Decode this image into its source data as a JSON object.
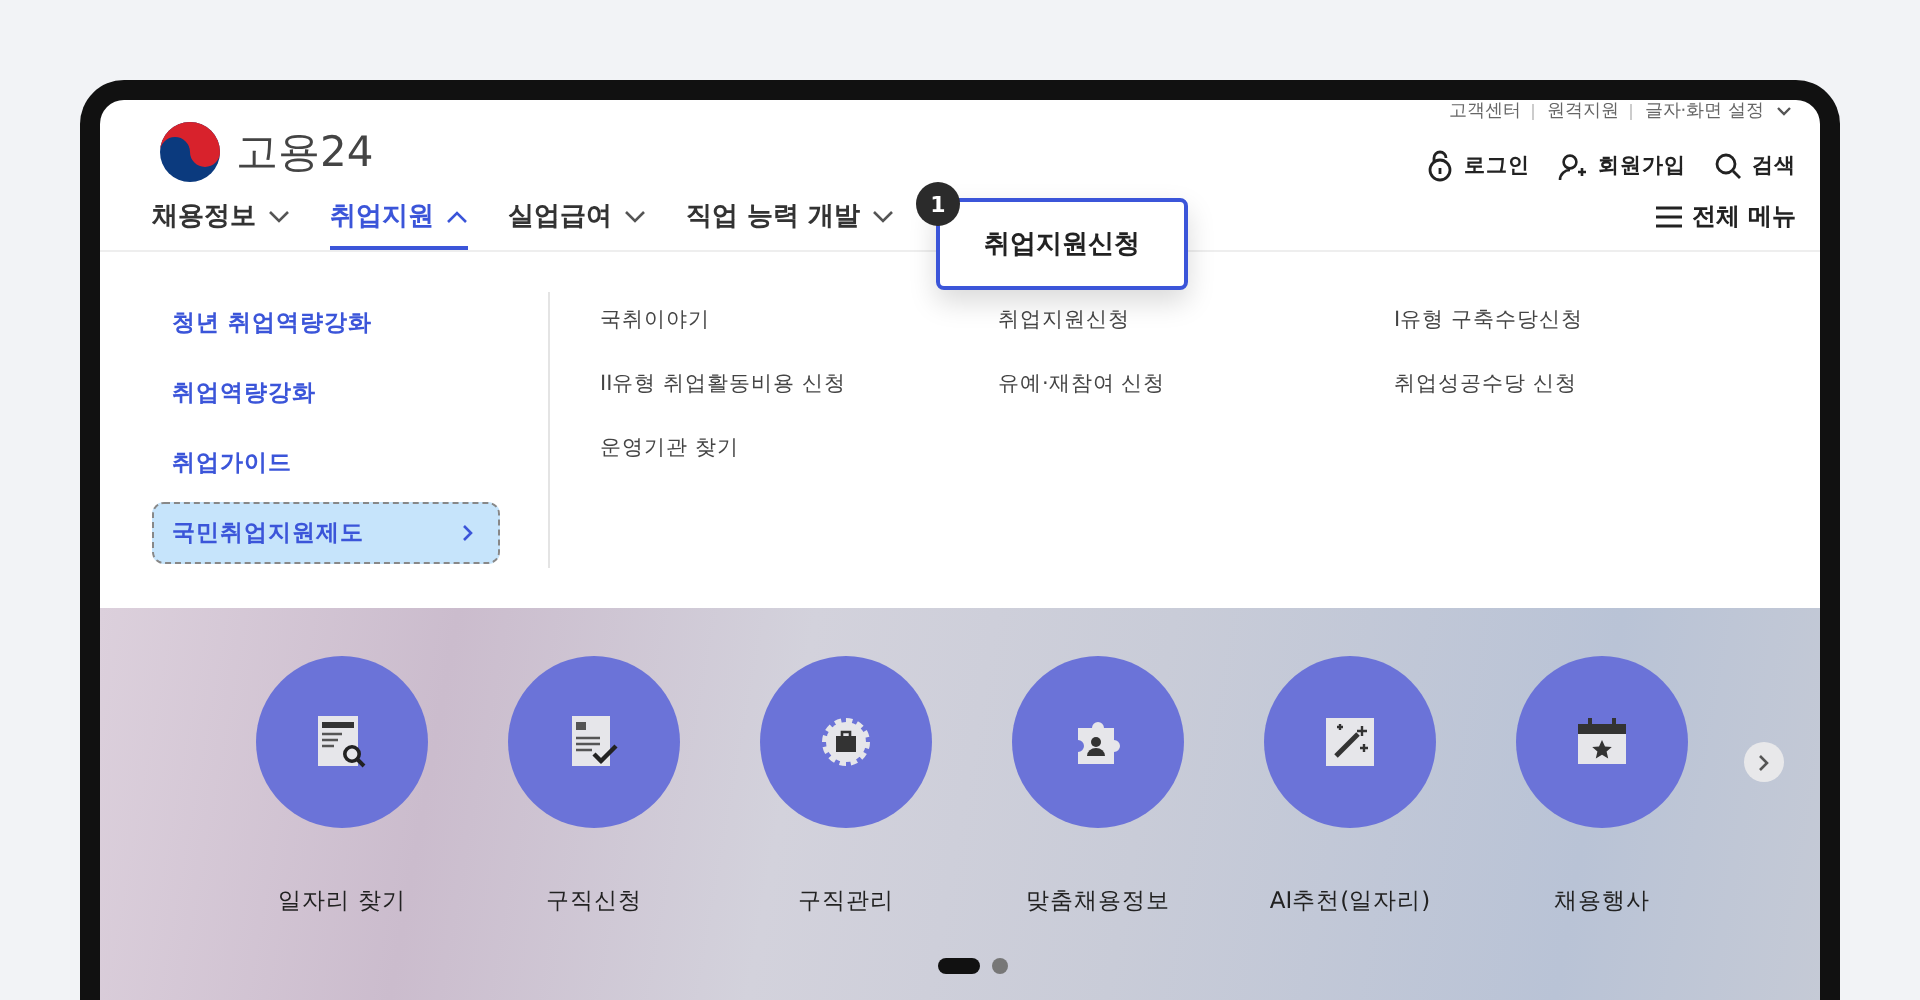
{
  "utility_links": [
    {
      "label": "고객센터"
    },
    {
      "label": "원격지원"
    },
    {
      "label": "글자·화면 설정"
    }
  ],
  "logo": {
    "text": "고용24"
  },
  "account_links": [
    {
      "label": "로그인",
      "kind": "login"
    },
    {
      "label": "회원가입",
      "kind": "signup"
    },
    {
      "label": "검색",
      "kind": "search"
    }
  ],
  "nav": [
    {
      "label": "채용정보",
      "expanded": false
    },
    {
      "label": "취업지원",
      "expanded": true
    },
    {
      "label": "실업급여",
      "expanded": false
    },
    {
      "label": "직업 능력 개발",
      "expanded": false
    }
  ],
  "full_menu": {
    "label": "전체 메뉴"
  },
  "mega_menu": {
    "categories": [
      {
        "label": "청년 취업역량강화",
        "selected": false
      },
      {
        "label": "취업역량강화",
        "selected": false
      },
      {
        "label": "취업가이드",
        "selected": false
      },
      {
        "label": "국민취업지원제도",
        "selected": true
      }
    ],
    "links": [
      "국취이야기",
      "취업지원신청",
      "I유형 구축수당신청",
      "II유형 취업활동비용 신청",
      "유예·재참여 신청",
      "취업성공수당 신청",
      "운영기관 찾기"
    ]
  },
  "callout": {
    "number": "1",
    "label": "취업지원신청"
  },
  "quick_menu": [
    {
      "label": "일자리 찾기",
      "kind": "job-search"
    },
    {
      "label": "구직신청",
      "kind": "application"
    },
    {
      "label": "구직관리",
      "kind": "manage"
    },
    {
      "label": "맞춤채용정보",
      "kind": "match"
    },
    {
      "label": "AI추천(일자리)",
      "kind": "ai"
    },
    {
      "label": "채용행사",
      "kind": "event"
    }
  ],
  "carousel": {
    "pages": [
      {
        "selected": true
      },
      {
        "selected": false
      }
    ]
  }
}
